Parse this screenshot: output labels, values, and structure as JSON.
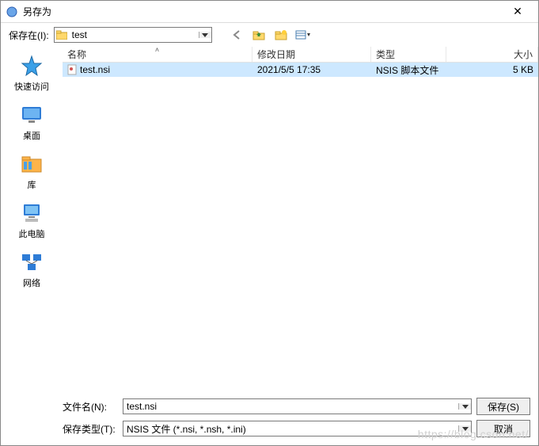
{
  "title": "另存为",
  "save_in_label": "保存在(I):",
  "current_folder": "test",
  "toolbar": {
    "back_tip": "back",
    "up_tip": "up",
    "newfolder_tip": "new-folder",
    "view_tip": "view"
  },
  "places": [
    {
      "label": "快速访问",
      "icon": "quickaccess"
    },
    {
      "label": "桌面",
      "icon": "desktop"
    },
    {
      "label": "库",
      "icon": "libraries"
    },
    {
      "label": "此电脑",
      "icon": "thispc"
    },
    {
      "label": "网络",
      "icon": "network"
    }
  ],
  "columns": {
    "name": "名称",
    "date": "修改日期",
    "type": "类型",
    "size": "大小"
  },
  "files": [
    {
      "name": "test.nsi",
      "date": "2021/5/5 17:35",
      "type": "NSIS 脚本文件",
      "size": "5 KB",
      "selected": true
    }
  ],
  "filename_label": "文件名(N):",
  "filetype_label": "保存类型(T):",
  "filename_value": "test.nsi",
  "filetype_value": "NSIS 文件 (*.nsi, *.nsh, *.ini)",
  "buttons": {
    "save": "保存(S)",
    "cancel": "取消"
  },
  "watermark": "https://blog.csdn.net/"
}
